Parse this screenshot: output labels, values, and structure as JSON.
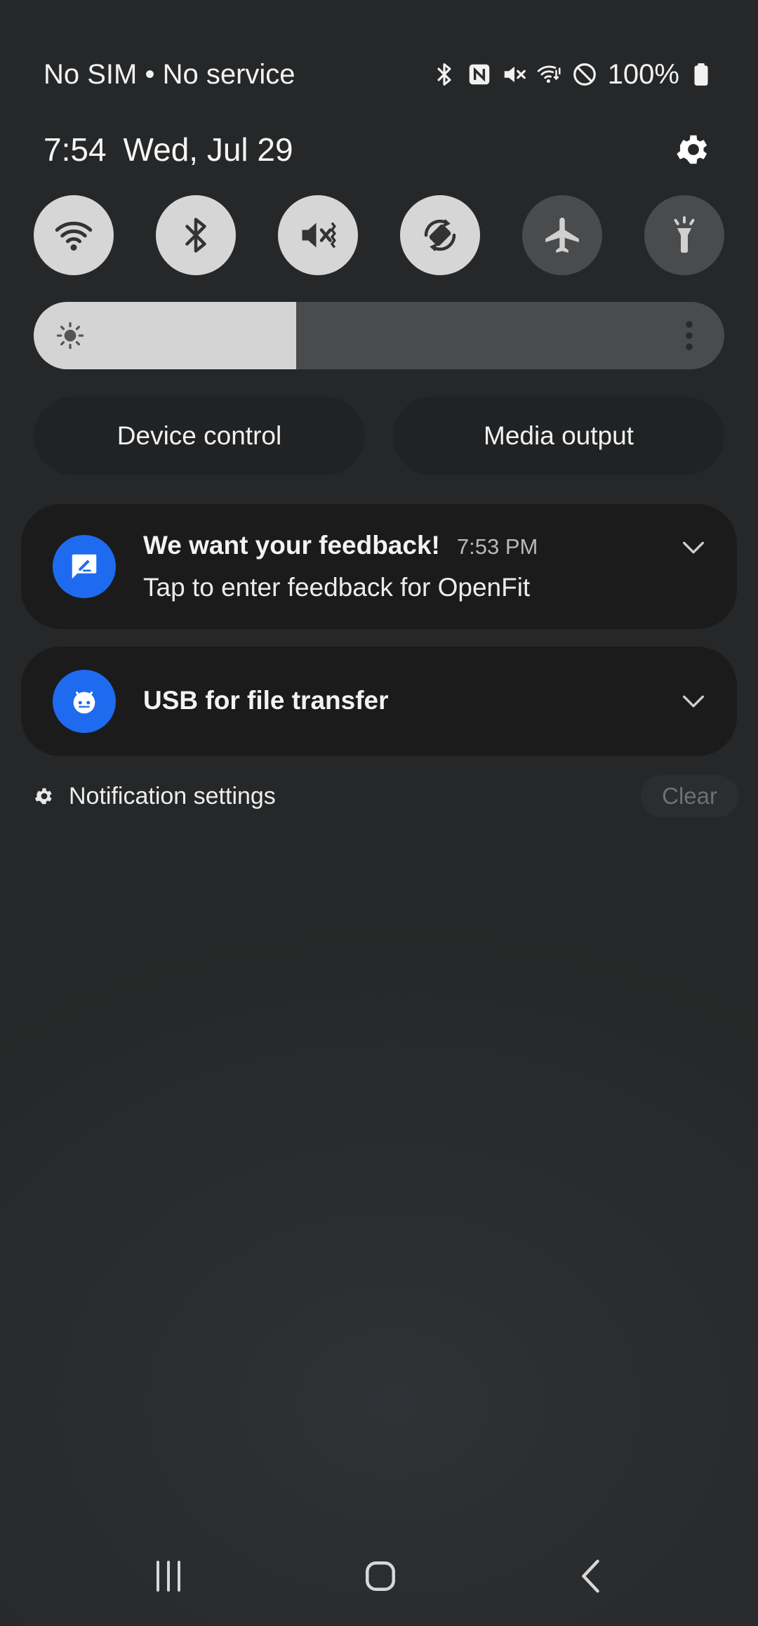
{
  "status_bar": {
    "carrier_text": "No SIM • No service",
    "battery_percent": "100%",
    "icons": [
      "bluetooth-icon",
      "nfc-icon",
      "mute-icon",
      "wifi-calling-icon",
      "do-not-disturb-icon",
      "battery-icon"
    ]
  },
  "header": {
    "time": "7:54",
    "date": "Wed, Jul 29",
    "settings_icon": "gear-icon"
  },
  "quick_tiles": [
    {
      "name": "wifi",
      "icon": "wifi-icon",
      "active": true
    },
    {
      "name": "bluetooth",
      "icon": "bluetooth-icon",
      "active": true
    },
    {
      "name": "sound",
      "icon": "mute-icon",
      "active": true
    },
    {
      "name": "auto-rotate",
      "icon": "rotate-icon",
      "active": true
    },
    {
      "name": "airplane-mode",
      "icon": "airplane-icon",
      "active": false
    },
    {
      "name": "flashlight",
      "icon": "flashlight-icon",
      "active": false
    }
  ],
  "brightness": {
    "level": 0.38
  },
  "controls": {
    "device_control": "Device control",
    "media_output": "Media output"
  },
  "notifications": [
    {
      "title": "We want your feedback!",
      "time": "7:53 PM",
      "body": "Tap to enter feedback for OpenFit",
      "icon": "feedback-icon",
      "accent": "#1f6bef"
    },
    {
      "title": "USB for file transfer",
      "icon": "usb-android-icon",
      "accent": "#1f6bef"
    }
  ],
  "footer": {
    "settings_label": "Notification settings",
    "clear_label": "Clear"
  },
  "navigation": {
    "recents_icon": "recents-icon",
    "home_icon": "home-icon",
    "back_icon": "back-icon"
  }
}
